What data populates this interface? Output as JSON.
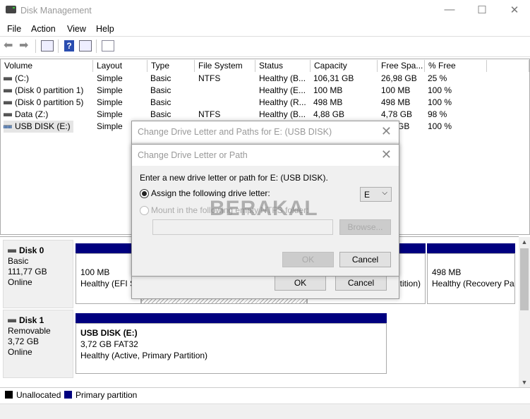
{
  "window": {
    "title": "Disk Management",
    "minimize": "—",
    "maximize": "☐",
    "close": "✕"
  },
  "menu": [
    "File",
    "Action",
    "View",
    "Help"
  ],
  "toolbar": {
    "icons": [
      "back-arrow-icon",
      "forward-arrow-icon",
      "console-tree-icon",
      "help-icon",
      "action-pane-icon",
      "properties-checklist-icon"
    ]
  },
  "volumes": {
    "columns": [
      "Volume",
      "Layout",
      "Type",
      "File System",
      "Status",
      "Capacity",
      "Free Spa...",
      "% Free"
    ],
    "rows": [
      [
        "(C:)",
        "Simple",
        "Basic",
        "NTFS",
        "Healthy (B...",
        "106,31 GB",
        "26,98 GB",
        "25 %"
      ],
      [
        "(Disk 0 partition 1)",
        "Simple",
        "Basic",
        "",
        "Healthy (E...",
        "100 MB",
        "100 MB",
        "100 %"
      ],
      [
        "(Disk 0 partition 5)",
        "Simple",
        "Basic",
        "",
        "Healthy (R...",
        "498 MB",
        "498 MB",
        "100 %"
      ],
      [
        "Data (Z:)",
        "Simple",
        "Basic",
        "NTFS",
        "Healthy (B...",
        "4,88 GB",
        "4,78 GB",
        "98 %"
      ],
      [
        "USB DISK (E:)",
        "Simple",
        "",
        "",
        "",
        "",
        "GB",
        "100 %"
      ]
    ]
  },
  "disks": [
    {
      "name": "Disk 0",
      "type": "Basic",
      "size": "111,77 GB",
      "state": "Online",
      "partitions": [
        {
          "size": "100 MB",
          "status": "Healthy (EFI S"
        },
        {
          "size": "",
          "status": ""
        },
        {
          "size": "",
          "status": "tition)"
        },
        {
          "size": "498 MB",
          "status": "Healthy (Recovery Pa"
        }
      ]
    },
    {
      "name": "Disk 1",
      "type": "Removable",
      "size": "3,72 GB",
      "state": "Online",
      "partitions": [
        {
          "name": "USB DISK  (E:)",
          "size": "3,72 GB FAT32",
          "status": "Healthy (Active, Primary Partition)"
        }
      ]
    }
  ],
  "legend": {
    "unallocated": "Unallocated",
    "primary": "Primary partition",
    "colors": {
      "unallocated": "#000000",
      "primary": "#00007f"
    }
  },
  "dialog_paths": {
    "title": "Change Drive Letter and Paths for E: (USB DISK)",
    "ok": "OK",
    "cancel": "Cancel"
  },
  "dialog_letter": {
    "title": "Change Drive Letter or Path",
    "prompt": "Enter a new drive letter or path for E: (USB DISK).",
    "assign_label": "Assign the following drive letter:",
    "assign_selected": true,
    "drive_letter": "E",
    "mount_label": "Mount in the following empty NTFS folder:",
    "folder_value": "",
    "browse": "Browse...",
    "ok": "OK",
    "cancel": "Cancel"
  },
  "watermark": "BERAKAL"
}
